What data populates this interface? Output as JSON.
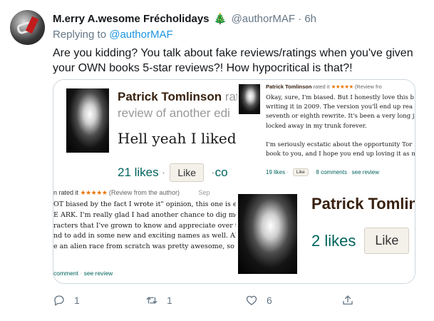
{
  "tweet": {
    "display_name": "M.erry A.wesome Frécholidays",
    "emoji": "🎄",
    "handle": "@authorMAF",
    "separator": "·",
    "time": "6h",
    "replying_prefix": "Replying to",
    "replying_to": "@authorMAF",
    "text": "Are you kidding? You talk about fake reviews/ratings when you've given your OWN books 5-star reviews?! How hypocritical is that?!"
  },
  "screenshot_left": {
    "name": "Patrick Tomlinson",
    "rated_suffix": "rat",
    "subtitle": "review of another edi",
    "body": "Hell yeah I liked it",
    "likes": "21 likes",
    "dot": "·",
    "like_button": "Like",
    "trailing": "co",
    "rated_prefix": "n rated it",
    "stars": "★★★★★",
    "review_note": "(Review from the author)",
    "date_partial": "Sep",
    "review_lines": [
      "OT biased by the fact I wrote it\" opinion, this one is e",
      "E ARK. I'm really glad I had another chance to dig mo",
      "racters that I've grown to know and appreciate over t",
      "nd to add in some new and exciting names as well. Al",
      "e an alien race from scratch was pretty awesome, so t"
    ],
    "footer_comment": "comment",
    "footer_see_review": "see review"
  },
  "screenshot_right": {
    "name": "Patrick Tomlinson",
    "rated": "rated it",
    "stars": "★★★★★",
    "review_note": "(Review fro",
    "review_lines": [
      "Okay, sure, I'm biased. But I honestly love this b",
      "writing it in 2009. The version you'll end up rea",
      "seventh or eighth rewrite. It's been a very long j",
      "locked away in my trunk forever.",
      "",
      "I'm seriously ecstatic about the opportunity Tor",
      "book to you, and I hope you end up loving it as n"
    ],
    "likes": "19 likes",
    "like_button": "Like",
    "comments": "8 comments",
    "see_review": "see review"
  },
  "overlay": {
    "name": "Patrick Tomlin",
    "likes": "2 likes",
    "dot": "·",
    "like_button": "Like"
  },
  "actions": {
    "reply_count": "1",
    "retweet_count": "1",
    "like_count": "6"
  },
  "colors": {
    "link": "#1b95e0",
    "muted": "#657786",
    "goodreads_green": "#00635d",
    "goodreads_brown": "#382110",
    "star_orange": "#e87400"
  }
}
